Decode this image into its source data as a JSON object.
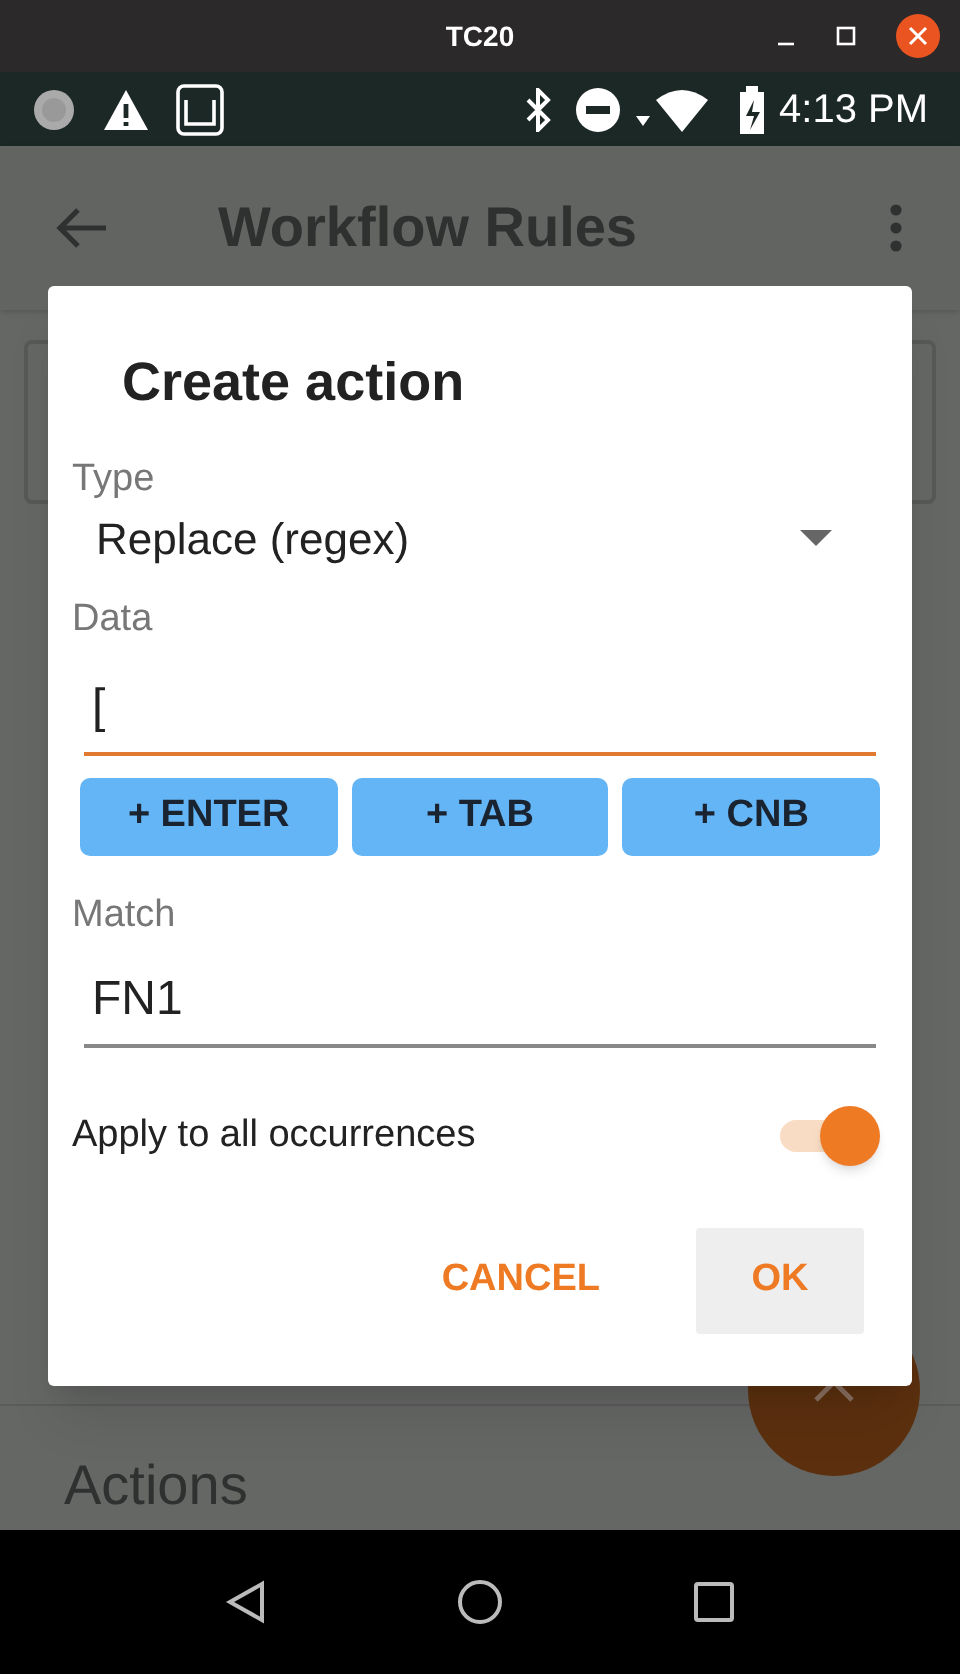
{
  "window": {
    "title": "TC20"
  },
  "status_bar": {
    "time": "4:13 PM"
  },
  "app_bar": {
    "title": "Workflow Rules"
  },
  "background": {
    "section_heading": "Actions"
  },
  "dialog": {
    "title": "Create action",
    "type": {
      "label": "Type",
      "value": "Replace (regex)"
    },
    "data": {
      "label": "Data",
      "value": "[",
      "focused": true
    },
    "insert_buttons": [
      "+ ENTER",
      "+ TAB",
      "+ CNB"
    ],
    "match": {
      "label": "Match",
      "value": "FN1",
      "focused": false
    },
    "apply_all": {
      "label": "Apply to all occurrences",
      "on": true
    },
    "buttons": [
      {
        "label": "CANCEL",
        "focused": false
      },
      {
        "label": "OK",
        "focused": true
      }
    ]
  }
}
